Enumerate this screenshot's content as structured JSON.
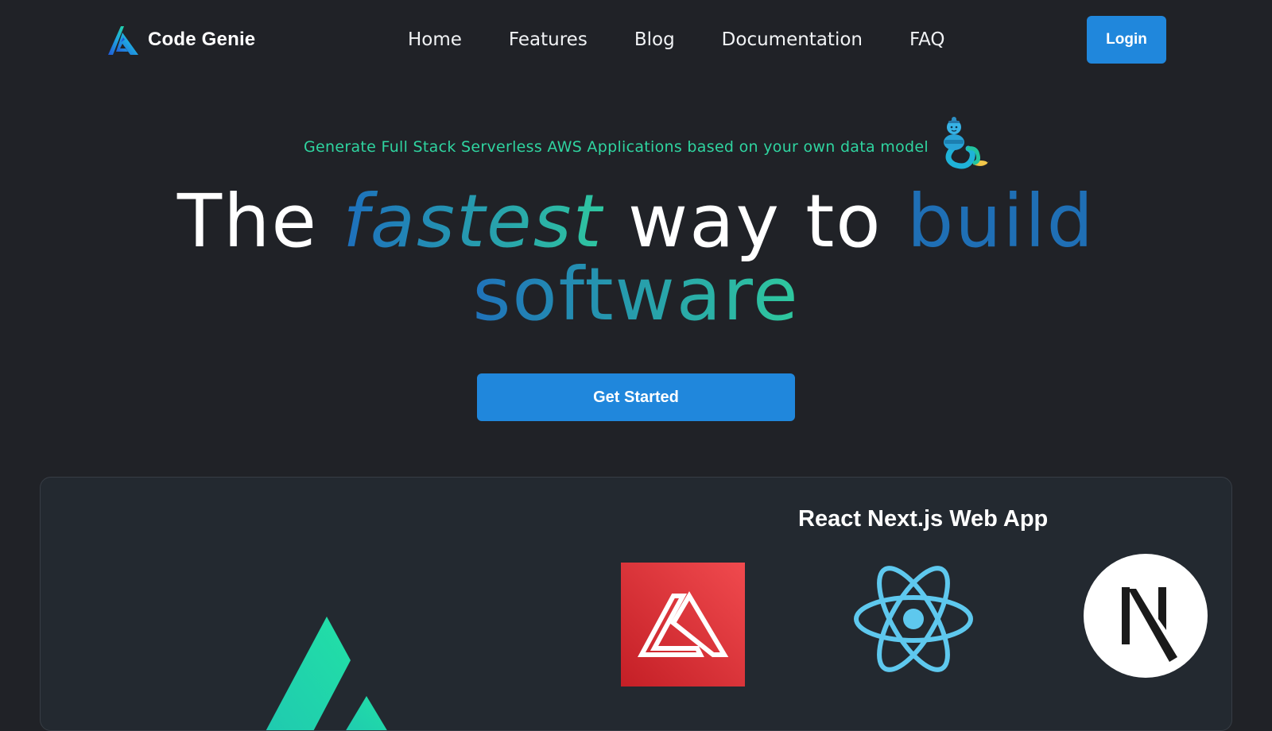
{
  "brand": {
    "name": "Code Genie"
  },
  "nav": {
    "links": [
      "Home",
      "Features",
      "Blog",
      "Documentation",
      "FAQ"
    ],
    "login_label": "Login"
  },
  "hero": {
    "tagline": "Generate Full Stack Serverless AWS Applications based on your own data model",
    "headline": {
      "w1": "The",
      "w2": "fastest",
      "w3": "way to",
      "w4": "build",
      "w5": "software"
    },
    "cta_label": "Get Started"
  },
  "showcase": {
    "title": "React Next.js Web App",
    "logos": [
      "code-genie-logo",
      "aws-amplify-logo",
      "react-logo",
      "nextjs-logo"
    ]
  },
  "colors": {
    "background": "#202227",
    "accent_blue": "#2087dc",
    "tagline_green": "#2fd4a0",
    "headline_blue": "#1f6fb5",
    "panel_bg": "#232930",
    "amplify_red": "#d9272e",
    "react_blue": "#61dafb"
  }
}
